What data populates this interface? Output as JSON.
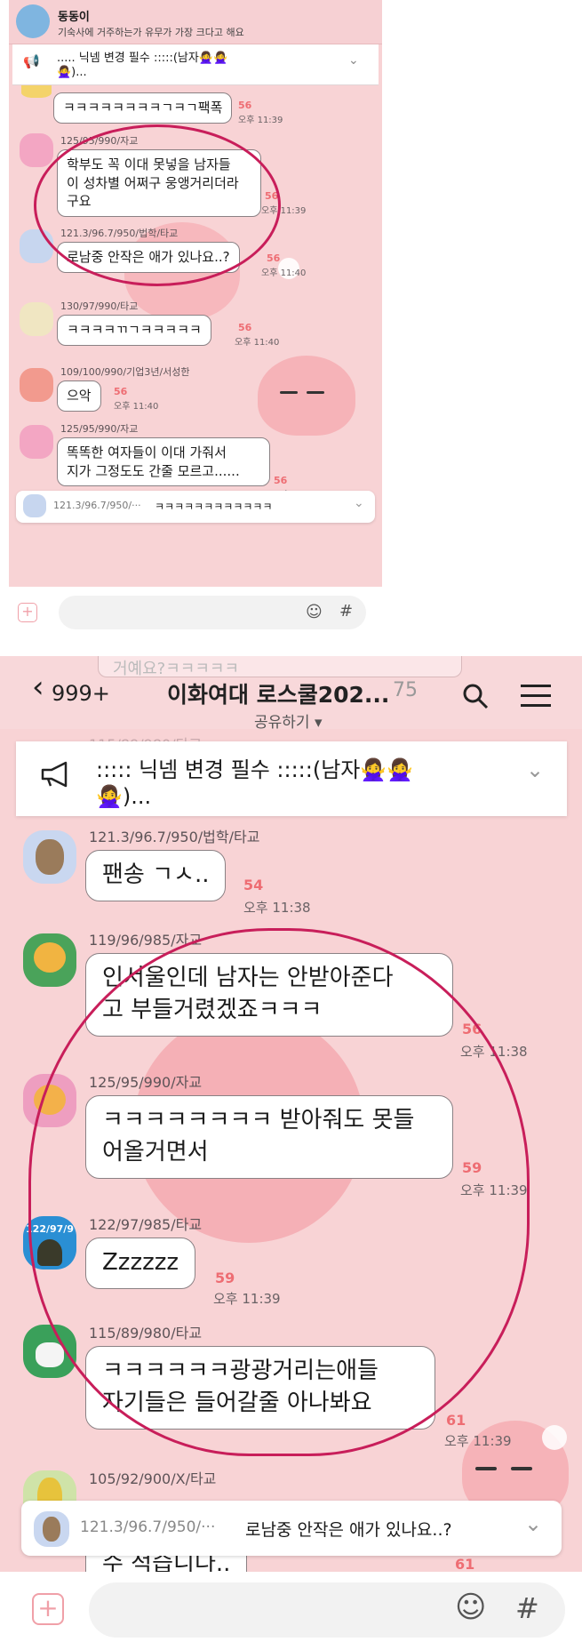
{
  "top_screen": {
    "notification": {
      "sender": "동동이",
      "message": "기숙사에 거주하는가 유무가 가장 크다고 해요"
    },
    "notice_snippet": "..... 닉넴 변경 필수 :::::(남자🙅‍♀️🙅‍♀️",
    "notice_snippet_2": "🙅‍♀️)...",
    "messages": [
      {
        "sender": "",
        "text": "ㅋㅋㅋㅋㅋㅋㅋㅋㄱㅋㄱ팩폭",
        "unread": "56",
        "time": "오후 11:39"
      },
      {
        "sender": "125/95/990/자교",
        "text": "학부도 꼭 이대 못넣을 남자들\n이 성차별 어쩌구 웅앵거리더라\n구요",
        "unread": "56",
        "time": "오후 11:39"
      },
      {
        "sender": "121.3/96.7/950/법학/타교",
        "text": "로남중 안작은 애가 있나요..?",
        "unread": "56",
        "time": "오후 11:40"
      },
      {
        "sender": "130/97/990/타교",
        "text": "ㅋㅋㅋㅋㄲㄱㅋㅋㅋㅋㅋ",
        "unread": "56",
        "time": "오후 11:40"
      },
      {
        "sender": "109/100/990/기업3년/서성한",
        "text": "으악",
        "unread": "56",
        "time": "오후 11:40"
      },
      {
        "sender": "125/95/990/자교",
        "text": "똑똑한 여자들이 이대 가줘서\n지가 그정도도 간줄 모르고......",
        "unread": "56",
        "time": "오후 11:40"
      }
    ],
    "reply_preview": {
      "sender": "121.3/96.7/950/···",
      "text": "ㅋㅋㅋㅋㅋㅋㅋㅋㅋㅋㅋㅋ"
    },
    "input_placeholder": ""
  },
  "bottom_screen": {
    "back_count": "999+",
    "title": "이화여대 로스쿨202...",
    "member_count": "75",
    "share_label": "공유하기 ▾",
    "notice": {
      "line1": "::::: 닉넴 변경 필수 :::::(남자🙅‍♀️🙅‍♀️",
      "line2": "🙅‍♀️)..."
    },
    "ghost_bubble": "거예요?ㅋㅋㅋㅋㅋ",
    "ghost_sender": "115/89/980/타교",
    "messages": [
      {
        "sender": "121.3/96.7/950/법학/타교",
        "text": "팬송 ㄱㅅ..",
        "unread": "54",
        "time": "오후 11:38"
      },
      {
        "sender": "119/96/985/자교",
        "text": "인서울인데 남자는 안받아준다\n고 부들거렸겠죠ㅋㅋㅋ",
        "unread": "56",
        "time": "오후 11:38"
      },
      {
        "sender": "125/95/990/자교",
        "text": "ㅋㅋㅋㅋㅋㅋㅋㅋ 받아줘도 못들\n어올거면서",
        "unread": "59",
        "time": "오후 11:39"
      },
      {
        "sender": "122/97/985/타교",
        "avatar_label": "122/97/9",
        "text": "Zzzzzz",
        "unread": "59",
        "time": "오후 11:39"
      },
      {
        "sender": "115/89/980/타교",
        "text": "ㅋㅋㅋㅋㅋㅋ광광거리는애들\n자기들은 들어갈줄 아나봐요",
        "unread": "61",
        "time": "오후 11:39"
      },
      {
        "sender": "105/92/900/X/타교",
        "text": "수 적습니다..",
        "unread": "61",
        "time": ""
      }
    ],
    "reply_preview": {
      "sender": "121.3/96.7/950/···",
      "text": "로남중 안작은 애가 있나요..?"
    }
  },
  "colors": {
    "chat_background": "#f8d3d5",
    "highlight_circle": "#c81e5a",
    "unread_count": "#ee6d73"
  },
  "icons": [
    "megaphone-icon",
    "chevron-down-icon",
    "back-chevron-icon",
    "search-icon",
    "menu-icon",
    "plus-icon",
    "emoji-icon",
    "hash-icon"
  ]
}
